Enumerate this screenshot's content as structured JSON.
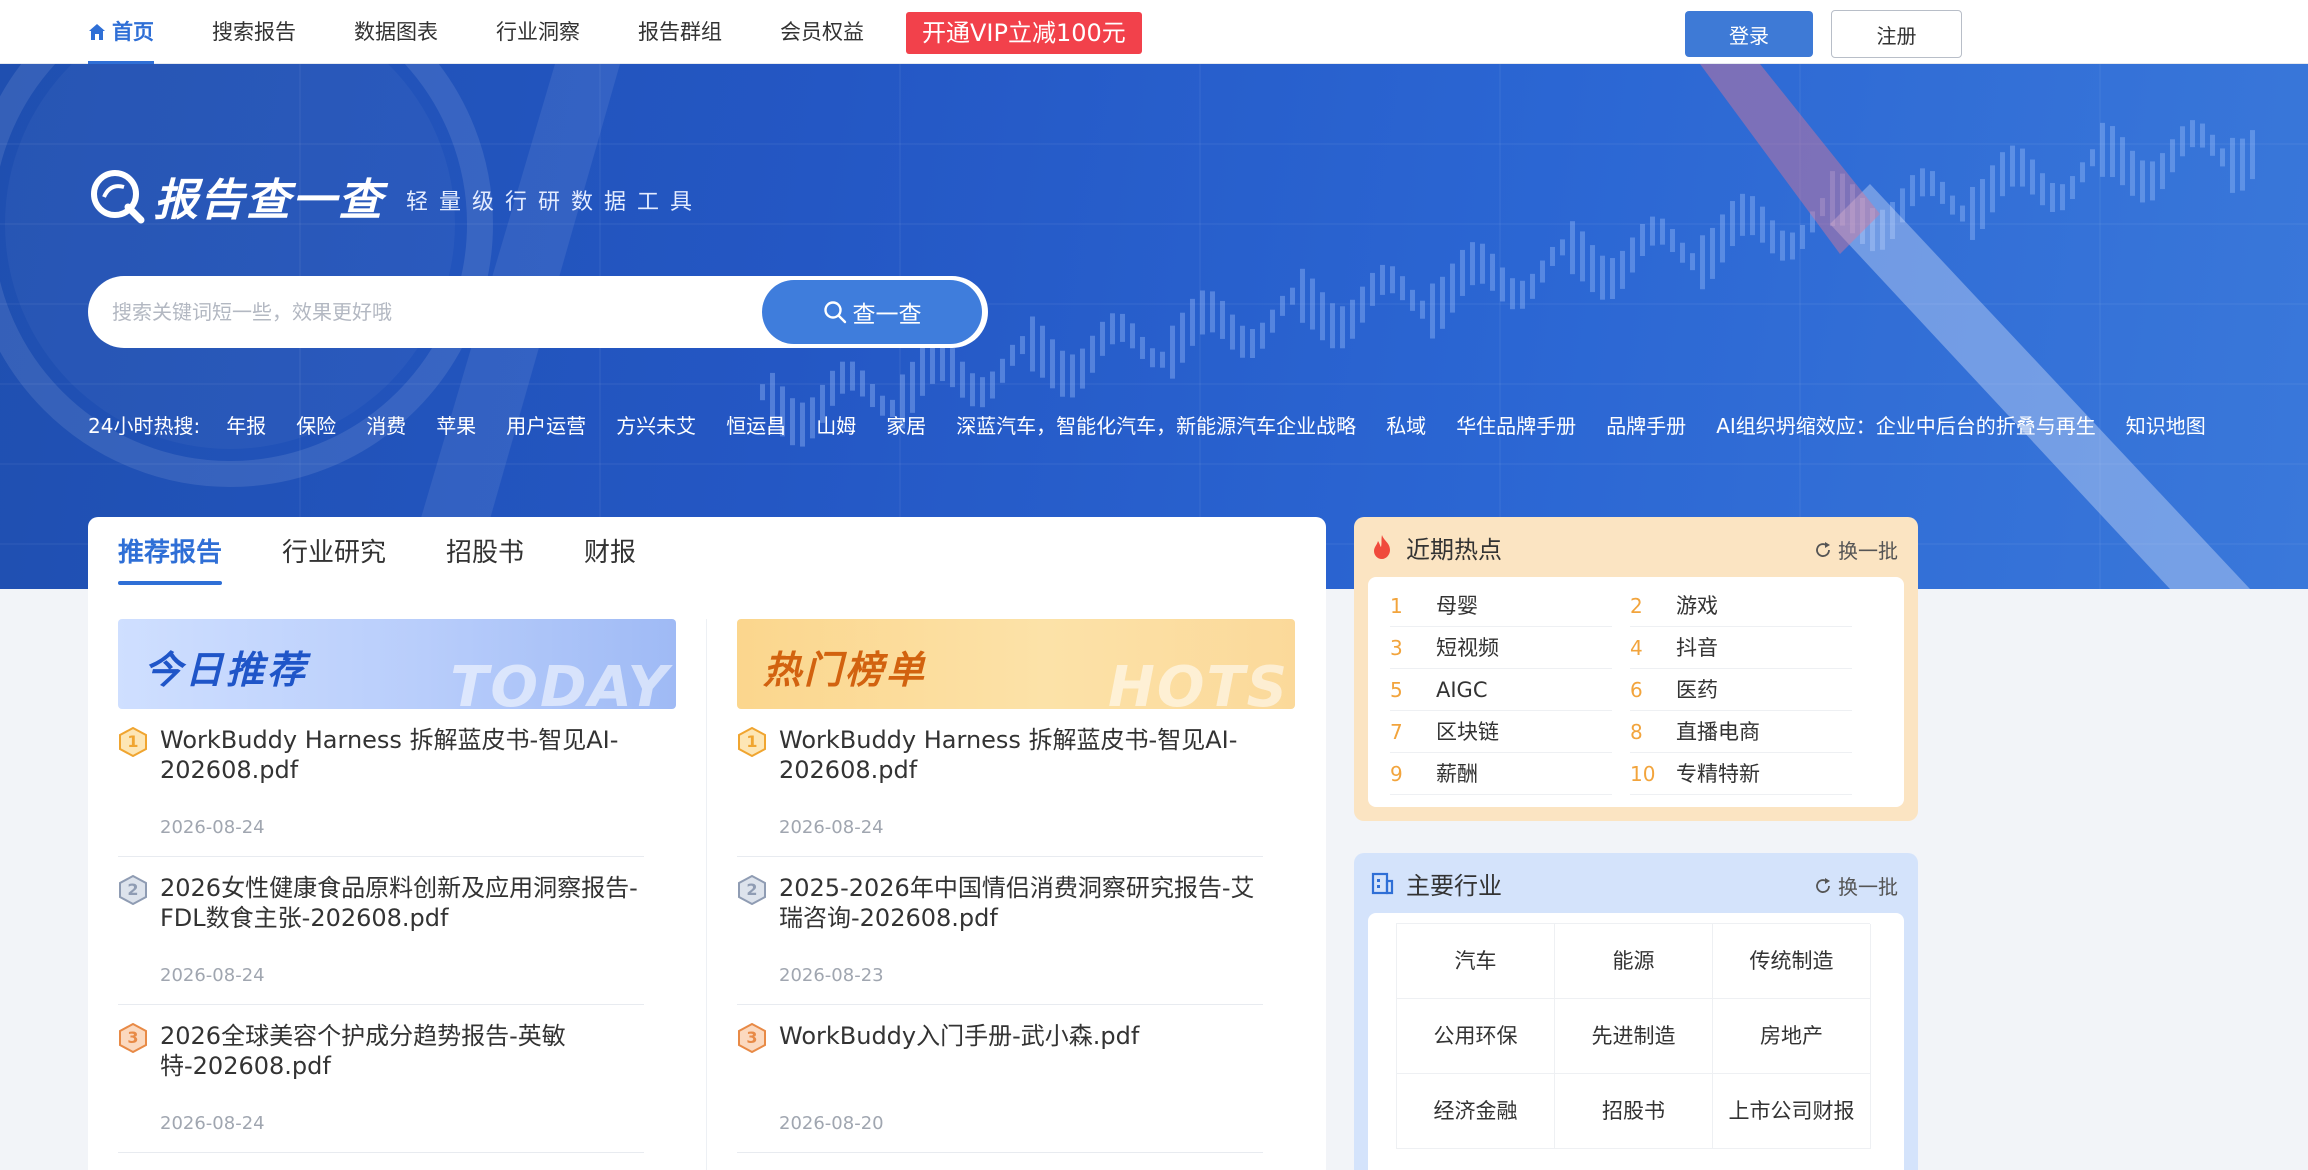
{
  "nav": {
    "items": [
      {
        "label": "首页",
        "active": true
      },
      {
        "label": "搜索报告"
      },
      {
        "label": "数据图表"
      },
      {
        "label": "行业洞察"
      },
      {
        "label": "报告群组"
      },
      {
        "label": "会员权益"
      }
    ],
    "vip_label": "开通VIP立减100元",
    "login_label": "登录",
    "register_label": "注册"
  },
  "hero": {
    "logo_text": "报告查一查",
    "tagline": "轻量级行研数据工具",
    "search_placeholder": "搜索关键词短一些，效果更好哦",
    "search_button": "查一查",
    "hot24_label": "24小时热搜:",
    "hot24": [
      "年报",
      "保险",
      "消费",
      "苹果",
      "用户运营",
      "方兴未艾",
      "恒运昌",
      "山姆",
      "家居",
      "深蓝汽车，智能化汽车，新能源汽车企业战略",
      "私域",
      "华住品牌手册",
      "品牌手册",
      "AI组织坍缩效应：企业中后台的折叠与再生",
      "知识地图"
    ]
  },
  "main": {
    "tabs": [
      "推荐报告",
      "行业研究",
      "招股书",
      "财报"
    ],
    "today": {
      "banner_title": "今日推荐",
      "banner_en": "TODAY",
      "reports": [
        {
          "rank": "1",
          "title": "WorkBuddy Harness 拆解蓝皮书-智见AI-202608.pdf",
          "date": "2026-08-24"
        },
        {
          "rank": "2",
          "title": "2026女性健康食品原料创新及应用洞察报告-FDL数食主张-202608.pdf",
          "date": "2026-08-24"
        },
        {
          "rank": "3",
          "title": "2026全球美容个护成分趋势报告-英敏特-202608.pdf",
          "date": "2026-08-24"
        }
      ]
    },
    "hots": {
      "banner_title": "热门榜单",
      "banner_en": "HOTS",
      "reports": [
        {
          "rank": "1",
          "title": "WorkBuddy Harness 拆解蓝皮书-智见AI-202608.pdf",
          "date": "2026-08-24"
        },
        {
          "rank": "2",
          "title": "2025-2026年中国情侣消费洞察研究报告-艾瑞咨询-202608.pdf",
          "date": "2026-08-23"
        },
        {
          "rank": "3",
          "title": "WorkBuddy入门手册-武小森.pdf",
          "date": "2026-08-20"
        }
      ]
    }
  },
  "hot_panel": {
    "title": "近期热点",
    "refresh": "换一批",
    "items": [
      {
        "num": "1",
        "label": "母婴"
      },
      {
        "num": "2",
        "label": "游戏"
      },
      {
        "num": "3",
        "label": "短视频"
      },
      {
        "num": "4",
        "label": "抖音"
      },
      {
        "num": "5",
        "label": "AIGC"
      },
      {
        "num": "6",
        "label": "医药"
      },
      {
        "num": "7",
        "label": "区块链"
      },
      {
        "num": "8",
        "label": "直播电商"
      },
      {
        "num": "9",
        "label": "薪酬"
      },
      {
        "num": "10",
        "label": "专精特新"
      }
    ]
  },
  "industry_panel": {
    "title": "主要行业",
    "refresh": "换一批",
    "items": [
      "汽车",
      "能源",
      "传统制造",
      "公用环保",
      "先进制造",
      "房地产",
      "经济金融",
      "招股书",
      "上市公司财报"
    ]
  }
}
